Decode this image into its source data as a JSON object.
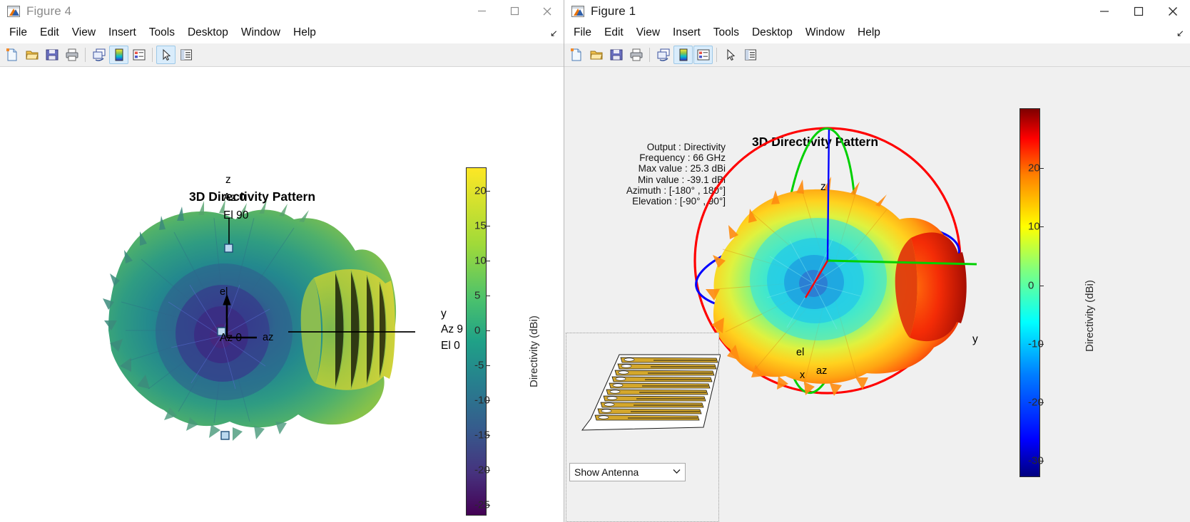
{
  "figure4": {
    "window": {
      "title": "Figure 4",
      "icon": "matlab-icon",
      "minimize": "─",
      "maximize": "□",
      "close": "✕"
    },
    "menus": [
      "File",
      "Edit",
      "View",
      "Insert",
      "Tools",
      "Desktop",
      "Window",
      "Help"
    ],
    "dock_arrow": "↘",
    "toolbar": [
      {
        "name": "new-figure-icon",
        "label": "New Figure"
      },
      {
        "name": "open-file-icon",
        "label": "Open File"
      },
      {
        "name": "save-figure-icon",
        "label": "Save Figure"
      },
      {
        "name": "print-figure-icon",
        "label": "Print Figure"
      },
      {
        "name": "link-plot-icon",
        "label": "Link Plot"
      },
      {
        "name": "colorbar-icon",
        "label": "Insert Colorbar",
        "selected": true
      },
      {
        "name": "legend-icon",
        "label": "Insert Legend",
        "selected": false
      },
      {
        "name": "pointer-icon",
        "label": "Edit Plot",
        "selected": true
      },
      {
        "name": "property-inspector-icon",
        "label": "Open Property Inspector",
        "selected": false
      }
    ],
    "plot": {
      "title": "3D Directivity Pattern",
      "labels": {
        "z": "z",
        "az0_top": "Az 0",
        "el90": "El 90",
        "el_axis": "el",
        "az_axis": "az",
        "az0_origin": "Az 0",
        "y": "y",
        "az90": "Az 9",
        "el0": "El 0"
      },
      "colorbar": {
        "label": "Directivity (dBi)",
        "colormap": "viridis",
        "ticks": [
          "20",
          "15",
          "10",
          "5",
          "0",
          "-5",
          "-10",
          "-15",
          "-20",
          "-25"
        ]
      }
    }
  },
  "figure1": {
    "window": {
      "title": "Figure 1",
      "icon": "matlab-icon",
      "minimize": "─",
      "maximize": "□",
      "close": "✕"
    },
    "menus": [
      "File",
      "Edit",
      "View",
      "Insert",
      "Tools",
      "Desktop",
      "Window",
      "Help"
    ],
    "dock_arrow": "↘",
    "toolbar": [
      {
        "name": "new-figure-icon",
        "label": "New Figure"
      },
      {
        "name": "open-file-icon",
        "label": "Open File"
      },
      {
        "name": "save-figure-icon",
        "label": "Save Figure"
      },
      {
        "name": "print-figure-icon",
        "label": "Print Figure"
      },
      {
        "name": "link-plot-icon",
        "label": "Link Plot"
      },
      {
        "name": "colorbar-icon",
        "label": "Insert Colorbar",
        "selected": true
      },
      {
        "name": "legend-icon",
        "label": "Insert Legend",
        "selected": true
      },
      {
        "name": "pointer-icon",
        "label": "Edit Plot",
        "selected": false
      },
      {
        "name": "property-inspector-icon",
        "label": "Open Property Inspector",
        "selected": false
      }
    ],
    "plot": {
      "title": "3D Directivity Pattern",
      "info": [
        "Output : Directivity",
        "Frequency : 66 GHz",
        "Max value : 25.3 dBi",
        "Min value : -39.1 dBi",
        "Azimuth : [-180° , 180°]",
        "Elevation : [-90° , 90°]"
      ],
      "labels": {
        "z": "z",
        "y": "y",
        "x": "x",
        "az_axis": "az",
        "el_axis": "el"
      },
      "colorbar": {
        "label": "Directivity (dBi)",
        "colormap": "jet",
        "ticks": [
          "20",
          "10",
          "0",
          "-10",
          "-20",
          "-30"
        ]
      },
      "antenna_panel": {
        "dropdown_value": "Show Antenna",
        "chevron": "⌄",
        "thumbnail_name": "vivaldi-antenna-array-thumbnail"
      }
    }
  },
  "chart_data": [
    {
      "type": "surface-3d",
      "title": "3D Directivity Pattern",
      "figure": "Figure 4",
      "colormap": "viridis",
      "clabel": "Directivity (dBi)",
      "clim": [
        -27,
        23
      ],
      "cticks": [
        20,
        15,
        10,
        5,
        0,
        -5,
        -10,
        -15,
        -20,
        -25
      ],
      "axes": [
        "az",
        "el",
        "z"
      ],
      "annotations": [
        "Az 0",
        "El 90",
        "El 0",
        "Az 9",
        "y",
        "az",
        "el",
        "z"
      ]
    },
    {
      "type": "surface-3d",
      "title": "3D Directivity Pattern",
      "figure": "Figure 1",
      "colormap": "jet",
      "clabel": "Directivity (dBi)",
      "clim": [
        -39.1,
        25.3
      ],
      "cticks": [
        20,
        10,
        0,
        -10,
        -20,
        -30
      ],
      "output": "Directivity",
      "frequency_ghz": 66,
      "max_value_dbi": 25.3,
      "min_value_dbi": -39.1,
      "azimuth_range_deg": [
        -180,
        180
      ],
      "elevation_range_deg": [
        -90,
        90
      ],
      "axes": [
        "x",
        "y",
        "z",
        "az",
        "el"
      ]
    }
  ],
  "colors": {
    "x_axis": "#ff0000",
    "y_axis": "#00d000",
    "z_axis": "#0000ff",
    "selected_tool": "#d9ecfb",
    "antenna_metal": "#d4a72c",
    "figure_bg": "#f0f0f0"
  }
}
